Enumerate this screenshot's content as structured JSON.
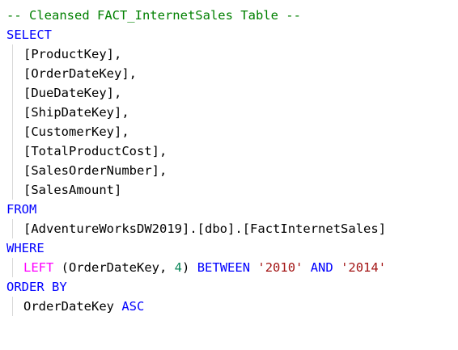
{
  "colors": {
    "comment": "#008000",
    "keyword": "#0000ff",
    "identifier": "#000000",
    "string": "#a31515",
    "number": "#098658",
    "function": "#ff00ff",
    "indent_guide": "#d9d9d9"
  },
  "code": {
    "comment": "-- Cleansed FACT_InternetSales Table --",
    "select_kw": "SELECT",
    "columns": [
      "ProductKey",
      "OrderDateKey",
      "DueDateKey",
      "ShipDateKey",
      "CustomerKey",
      "TotalProductCost",
      "SalesOrderNumber",
      "SalesAmount"
    ],
    "from_kw": "FROM",
    "from_parts": [
      "AdventureWorksDW2019",
      "dbo",
      "FactInternetSales"
    ],
    "where_kw": "WHERE",
    "where": {
      "func": "LEFT",
      "arg": "OrderDateKey",
      "len": "4",
      "between_kw": "BETWEEN",
      "low": "'2010'",
      "and_kw": "AND",
      "high": "'2014'"
    },
    "order_kw": "ORDER BY",
    "order_col": "OrderDateKey",
    "order_dir": "ASC"
  }
}
